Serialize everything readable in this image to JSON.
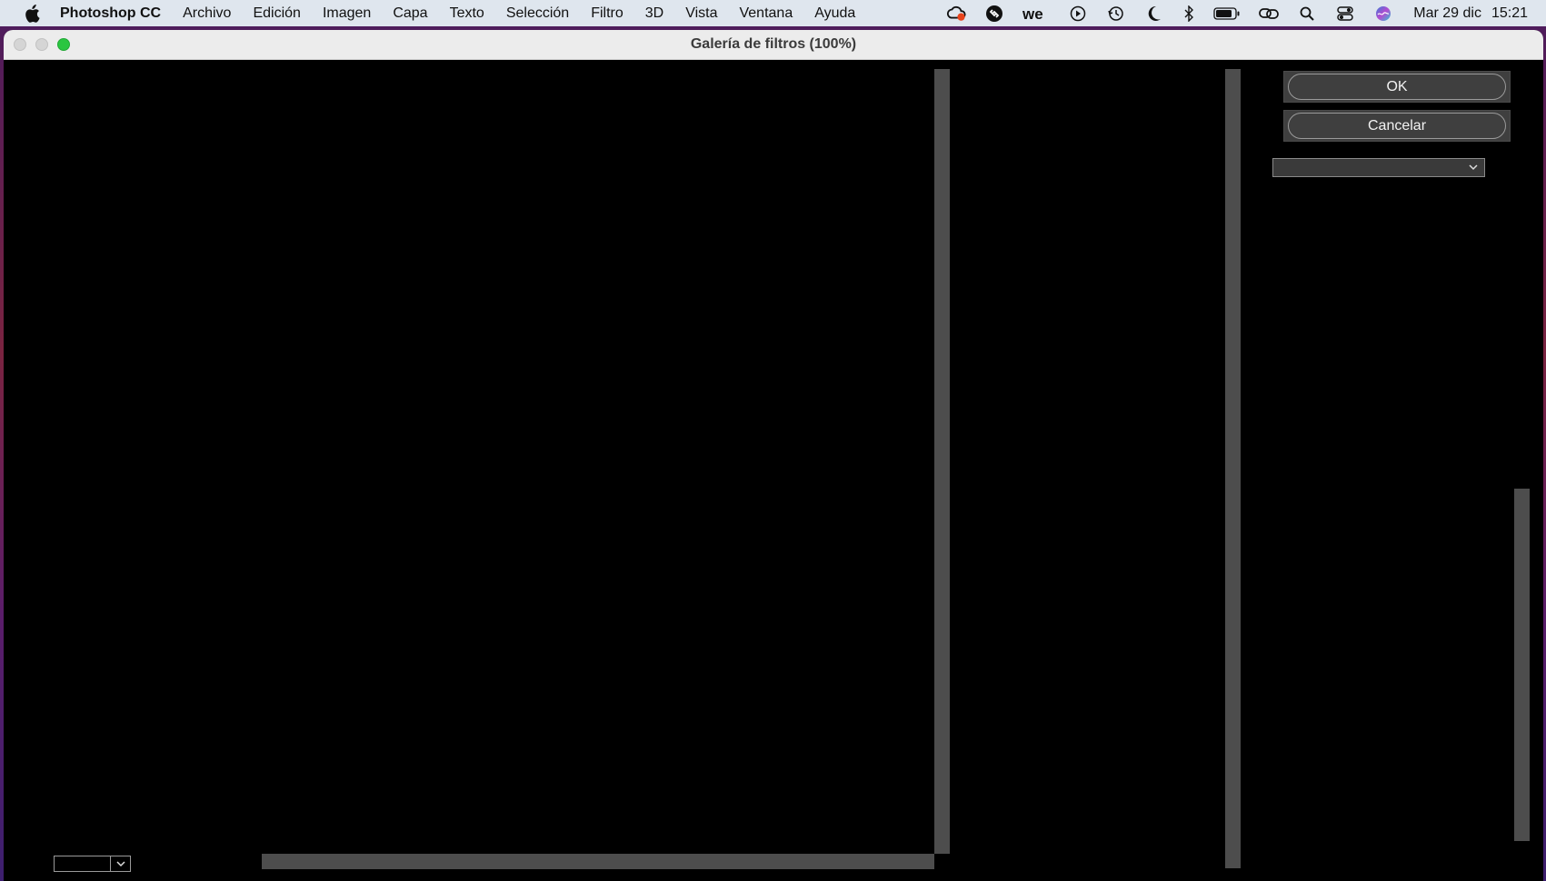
{
  "menubar": {
    "app_name": "Photoshop CC",
    "items": [
      "Archivo",
      "Edición",
      "Imagen",
      "Capa",
      "Texto",
      "Selección",
      "Filtro",
      "3D",
      "Vista",
      "Ventana",
      "Ayuda"
    ],
    "status_icons": [
      "creative-cloud-icon",
      "shazam-icon",
      "wetransfer-icon",
      "play-circle-icon",
      "time-machine-icon",
      "moon-icon",
      "bluetooth-icon",
      "battery-icon",
      "link-icon",
      "search-icon",
      "control-center-icon",
      "siri-icon"
    ],
    "clock": {
      "day": "Mar 29 dic",
      "time": "15:21"
    }
  },
  "window": {
    "title": "Galería de filtros (100%)"
  },
  "buttons": {
    "ok_label": "OK",
    "cancel_label": "Cancelar"
  },
  "filter_select": {
    "value": ""
  },
  "zoom_select": {
    "value": ""
  },
  "colors": {
    "dialog_bg": "#000000",
    "scrollbar": "#4d4d4d",
    "zoom_button": "#2ac640"
  }
}
